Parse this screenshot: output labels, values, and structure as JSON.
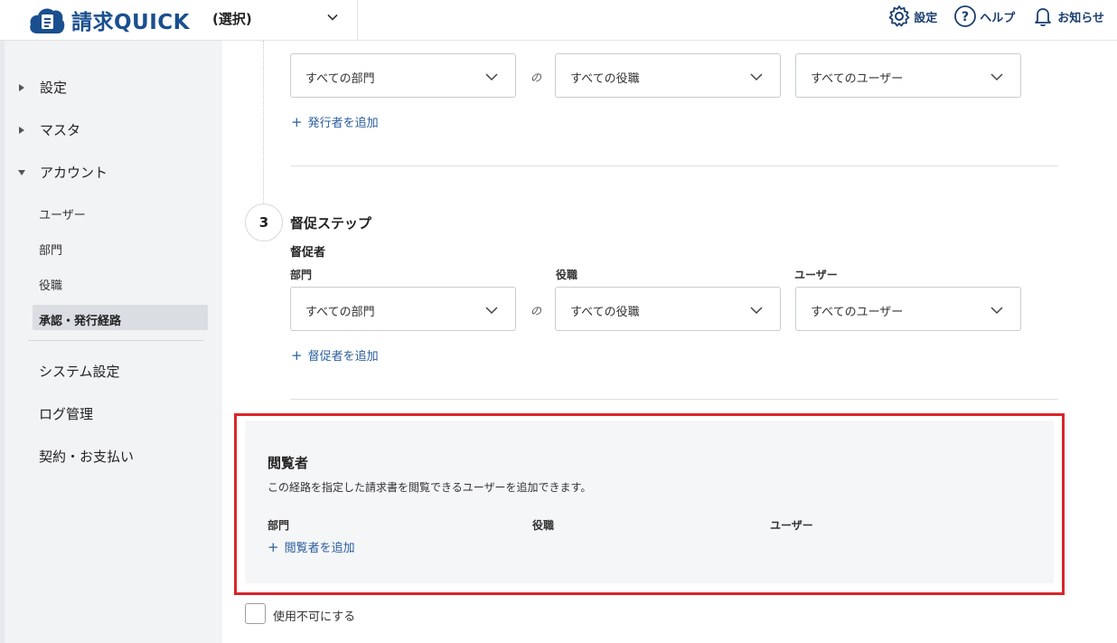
{
  "header": {
    "app_name": "請求QUICK",
    "org_select": "(選択)",
    "settings": "設定",
    "help": "ヘルプ",
    "notifications": "お知らせ"
  },
  "sidebar": {
    "items": [
      {
        "label": "設定",
        "expanded": false
      },
      {
        "label": "マスタ",
        "expanded": false
      },
      {
        "label": "アカウント",
        "expanded": true
      }
    ],
    "sub_items": [
      "ユーザー",
      "部門",
      "役職"
    ],
    "active_item": "承認・発行経路",
    "bottom_items": [
      "システム設定",
      "ログ管理",
      "契約・お支払い"
    ]
  },
  "main": {
    "issuer_section": {
      "dept_value": "すべての部門",
      "connector": "の",
      "position_value": "すべての役職",
      "user_value": "すべてのユーザー",
      "add_link": "発行者を追加"
    },
    "step3": {
      "number": "3",
      "title": "督促ステップ",
      "subtitle": "督促者",
      "dept_label": "部門",
      "position_label": "役職",
      "user_label": "ユーザー",
      "dept_value": "すべての部門",
      "connector": "の",
      "position_value": "すべての役職",
      "user_value": "すべてのユーザー",
      "add_link": "督促者を追加"
    },
    "viewer": {
      "title": "閲覧者",
      "description": "この経路を指定した請求書を閲覧できるユーザーを追加できます。",
      "dept_label": "部門",
      "position_label": "役職",
      "user_label": "ユーザー",
      "add_link": "閲覧者を追加"
    },
    "disable_label": "使用不可にする",
    "plus": "+"
  },
  "colors": {
    "brand": "#1a4f8f",
    "link": "#2b5f9e",
    "highlight": "#d9262b"
  }
}
